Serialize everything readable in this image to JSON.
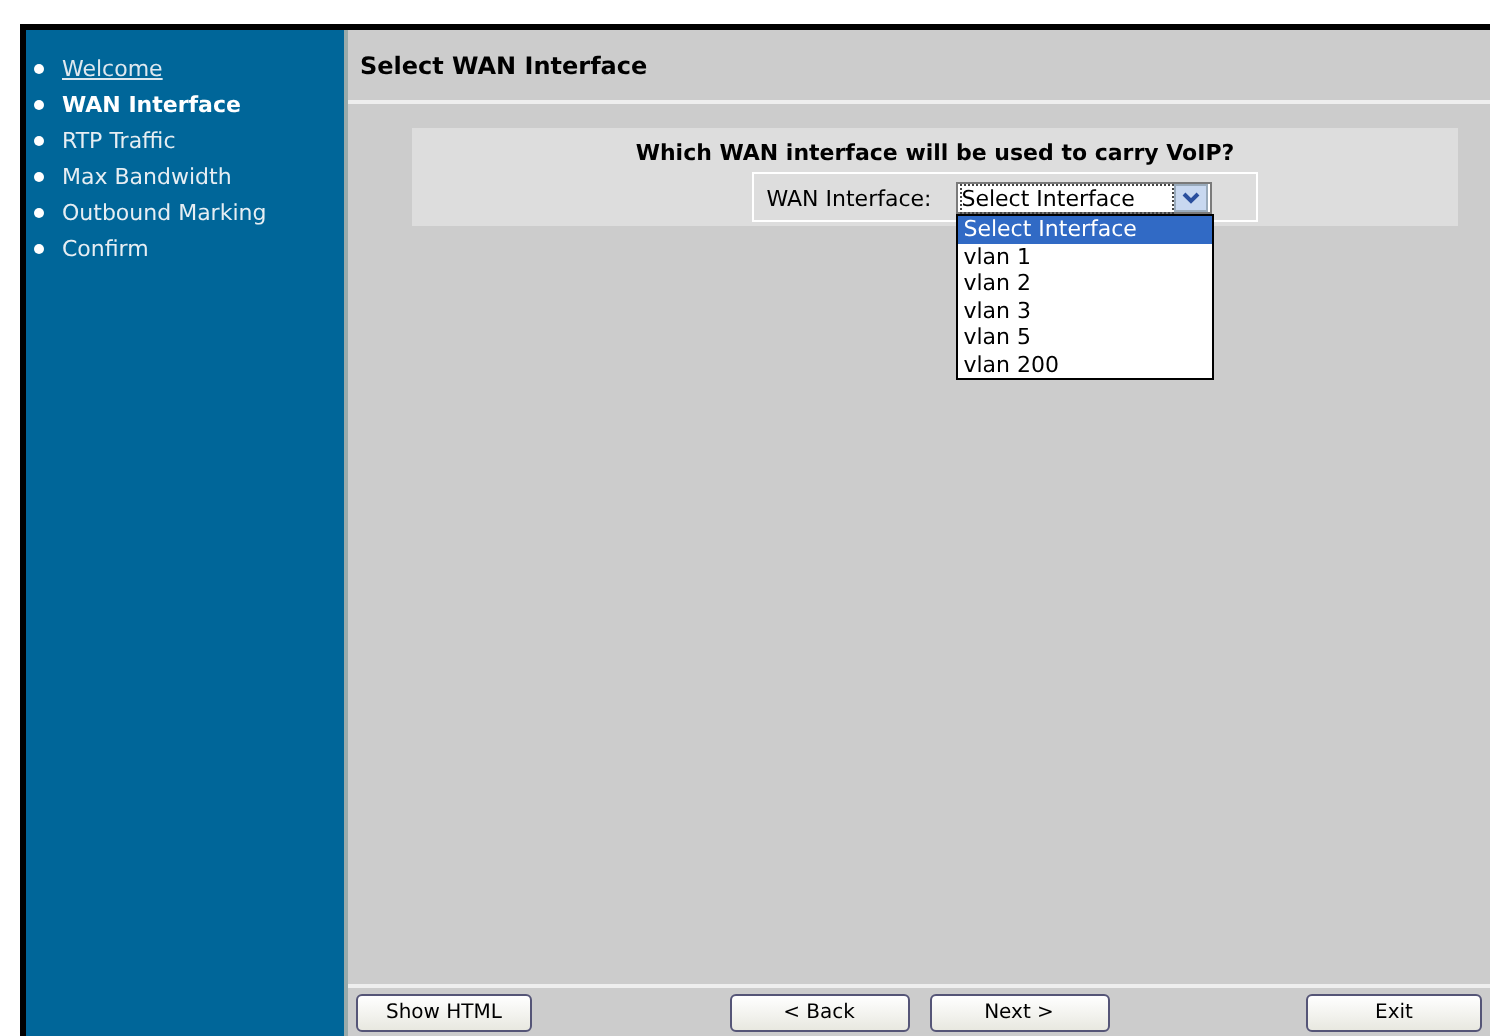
{
  "sidebar": {
    "items": [
      {
        "label": "Welcome",
        "kind": "link"
      },
      {
        "label": "WAN Interface",
        "kind": "current"
      },
      {
        "label": "RTP Traffic",
        "kind": "plain"
      },
      {
        "label": "Max Bandwidth",
        "kind": "plain"
      },
      {
        "label": "Outbound Marking",
        "kind": "plain"
      },
      {
        "label": "Confirm",
        "kind": "plain"
      }
    ]
  },
  "header": {
    "title": "Select WAN Interface"
  },
  "form": {
    "question": "Which WAN interface will be used to carry VoIP?",
    "field_label": "WAN Interface:",
    "select": {
      "value": "Select Interface",
      "expanded": true,
      "options": [
        {
          "label": "Select Interface",
          "selected": true
        },
        {
          "label": "vlan 1",
          "selected": false
        },
        {
          "label": "vlan 2",
          "selected": false
        },
        {
          "label": "vlan 3",
          "selected": false
        },
        {
          "label": "vlan 5",
          "selected": false
        },
        {
          "label": "vlan 200",
          "selected": false
        }
      ]
    }
  },
  "buttons": [
    {
      "label": "Show HTML",
      "kind": "left"
    },
    {
      "label": "< Back",
      "kind": "center"
    },
    {
      "label": "Next >",
      "kind": "center"
    },
    {
      "label": "Exit",
      "kind": "right"
    }
  ]
}
